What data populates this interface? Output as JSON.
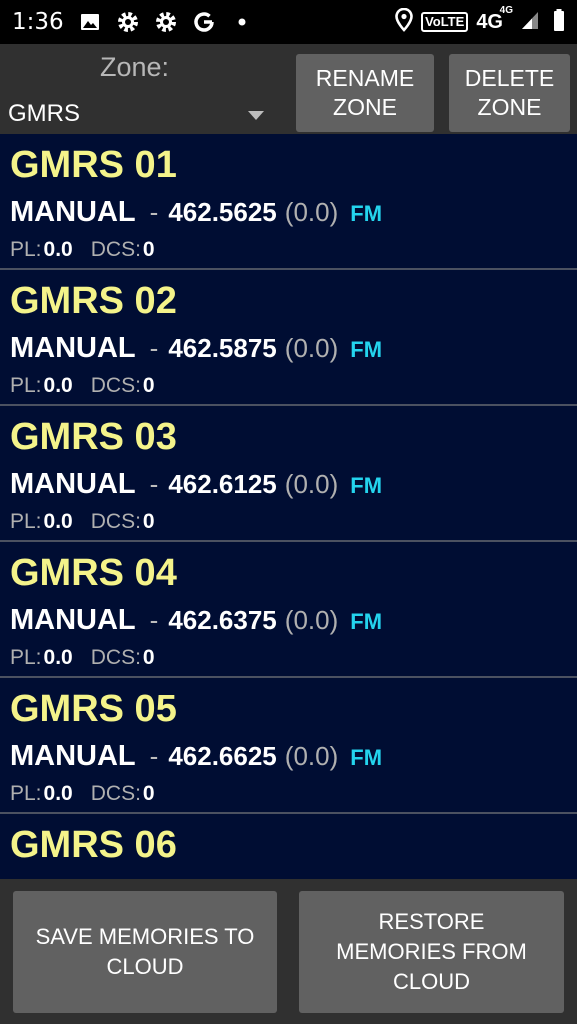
{
  "status_bar": {
    "time": "1:36",
    "volte": "VoLTE",
    "network": "4G",
    "network_sup": "4G"
  },
  "header": {
    "zone_label": "Zone:",
    "zone_value": "GMRS",
    "rename_line1": "RENAME",
    "rename_line2": "ZONE",
    "delete_line1": "DELETE",
    "delete_line2": "ZONE"
  },
  "memories": [
    {
      "name": "GMRS 01",
      "mode": "MANUAL",
      "dash": "-",
      "freq": "462.5625",
      "offset": "(0.0)",
      "modulation": "FM",
      "pl_label": "PL:",
      "pl": "0.0",
      "dcs_label": "DCS:",
      "dcs": "0"
    },
    {
      "name": "GMRS 02",
      "mode": "MANUAL",
      "dash": "-",
      "freq": "462.5875",
      "offset": "(0.0)",
      "modulation": "FM",
      "pl_label": "PL:",
      "pl": "0.0",
      "dcs_label": "DCS:",
      "dcs": "0"
    },
    {
      "name": "GMRS 03",
      "mode": "MANUAL",
      "dash": "-",
      "freq": "462.6125",
      "offset": "(0.0)",
      "modulation": "FM",
      "pl_label": "PL:",
      "pl": "0.0",
      "dcs_label": "DCS:",
      "dcs": "0"
    },
    {
      "name": "GMRS 04",
      "mode": "MANUAL",
      "dash": "-",
      "freq": "462.6375",
      "offset": "(0.0)",
      "modulation": "FM",
      "pl_label": "PL:",
      "pl": "0.0",
      "dcs_label": "DCS:",
      "dcs": "0"
    },
    {
      "name": "GMRS 05",
      "mode": "MANUAL",
      "dash": "-",
      "freq": "462.6625",
      "offset": "(0.0)",
      "modulation": "FM",
      "pl_label": "PL:",
      "pl": "0.0",
      "dcs_label": "DCS:",
      "dcs": "0"
    },
    {
      "name": "GMRS 06"
    }
  ],
  "footer": {
    "save_line1": "SAVE MEMORIES TO",
    "save_line2": "CLOUD",
    "restore_line1": "RESTORE",
    "restore_line2": "MEMORIES FROM",
    "restore_line3": "CLOUD"
  },
  "colors": {
    "name_yellow": "#f4f38a",
    "fm_cyan": "#24d4ee",
    "list_bg": "#000d33",
    "button_gray": "#616161"
  }
}
